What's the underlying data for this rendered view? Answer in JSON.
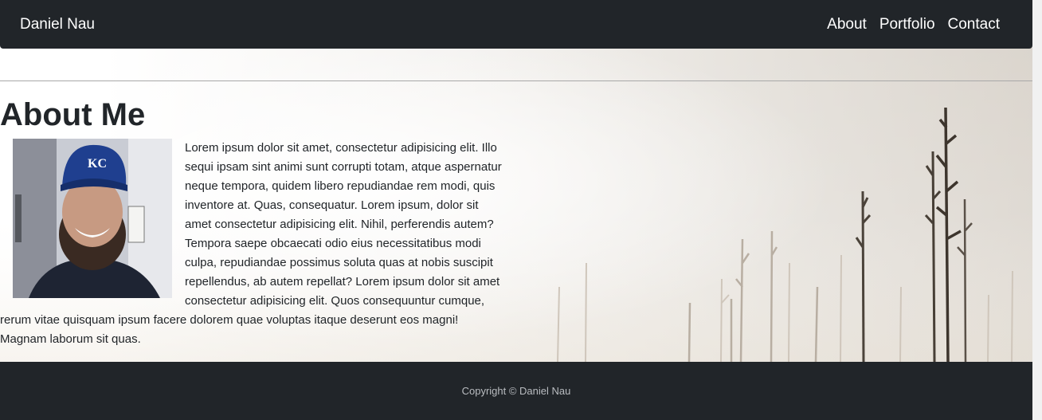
{
  "navbar": {
    "brand": "Daniel Nau",
    "links": [
      "About",
      "Portfolio",
      "Contact"
    ]
  },
  "main": {
    "heading": "About Me",
    "paragraph": "Lorem ipsum dolor sit amet, consectetur adipisicing elit. Illo sequi ipsam sint animi sunt corrupti totam, atque aspernatur neque tempora, quidem libero repudiandae rem modi, quis inventore at. Quas, consequatur. Lorem ipsum, dolor sit amet consectetur adipisicing elit. Nihil, perferendis autem? Tempora saepe obcaecati odio eius necessitatibus modi culpa, repudiandae possimus soluta quas at nobis suscipit repellendus, ab autem repellat? Lorem ipsum dolor sit amet consectetur adipisicing elit. Quos consequuntur cumque, rerum vitae quisquam ipsum facere dolorem quae voluptas itaque deserunt eos magni! Magnam laborum sit quas."
  },
  "footer": {
    "copyright": "Copyright © Daniel Nau"
  },
  "colors": {
    "navbar_bg": "#212529",
    "footer_bg": "#212529",
    "text": "#212529"
  }
}
